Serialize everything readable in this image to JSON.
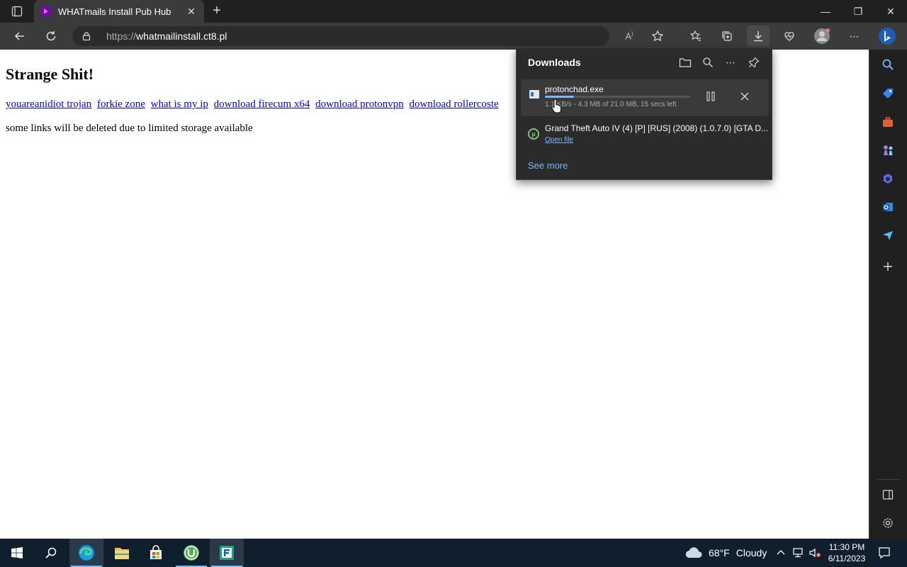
{
  "browser": {
    "tab": {
      "title": "WHATmails Install Pub Hub",
      "close": "✕"
    },
    "new_tab": "+",
    "window": {
      "minimize": "—",
      "restore": "❐",
      "close": "✕"
    },
    "address": {
      "protocol": "https://",
      "domain": "whatmailinstall.ct8.pl"
    }
  },
  "page": {
    "heading": "Strange Shit!",
    "links": [
      "youareanidiot trojan",
      "forkie zone",
      "what is my ip",
      "download firecum x64",
      "download protonvpn",
      "download rollercoste"
    ],
    "note": "some links will be deleted due to limited storage available"
  },
  "downloads": {
    "title": "Downloads",
    "items": [
      {
        "name": "protonchad.exe",
        "status": "1.1 KB/s - 4.3 MB of 21.0 MB, 15 secs left",
        "progress": 0.2
      },
      {
        "name": "Grand Theft Auto IV (4) [P] [RUS] (2008) (1.0.7.0) [GTA D...",
        "action": "Open file"
      }
    ],
    "see_more": "See more"
  },
  "taskbar": {
    "weather": {
      "temp": "68°F",
      "condition": "Cloudy"
    },
    "clock": {
      "time": "11:30 PM",
      "date": "6/11/2023"
    }
  },
  "colors": {
    "accent": "#79b8ff",
    "link": "#0000ee",
    "panel_bg": "#2b2b2b",
    "taskbar": "#0f1f2e"
  }
}
